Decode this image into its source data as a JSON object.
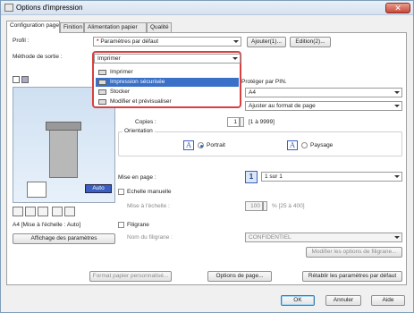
{
  "window": {
    "title": "Options d'impression",
    "close_glyph": "✕"
  },
  "tabs": [
    {
      "label": "Configuration page"
    },
    {
      "label": "Finition"
    },
    {
      "label": "Alimentation papier"
    },
    {
      "label": "Qualité"
    }
  ],
  "profile": {
    "label": "Profil :",
    "value": "Paramètres par défaut",
    "add_label": "Ajouter(1)...",
    "edit_label": "Edition(2)..."
  },
  "output_method": {
    "label": "Méthode de sortie :",
    "value": "Imprimer",
    "options": [
      "Imprimer",
      "Impression sécurisée",
      "Stocker",
      "Modifier et prévisualiser"
    ],
    "selected_index": 1
  },
  "pin_label": "Protéger par PIN.",
  "page_size_value": "A4",
  "output_size_value": "Ajuster au format de page",
  "copies": {
    "label": "Copies :",
    "value": "1",
    "range": "[1 à 9999]"
  },
  "orientation": {
    "label": "Orientation",
    "portrait_label": "Portrait",
    "landscape_label": "Paysage",
    "icon_letter": "A"
  },
  "layout": {
    "label": "Mise en page :",
    "value": "1 sur 1",
    "icon_digit": "1"
  },
  "manual_scale": {
    "label": "Echelle manuelle",
    "scale_label": "Mise à l'échelle :",
    "value": "100",
    "range": "% [25 à 400]"
  },
  "watermark": {
    "label": "Filigrane",
    "name_label": "Nom du filigrane :",
    "value": "CONFIDENTIEL",
    "edit_label": "Modifier les options de filigrane..."
  },
  "preview": {
    "auto_label": "Auto",
    "caption": "A4 [Mise à l'échelle : Auto]",
    "show_settings_label": "Affichage des paramètres"
  },
  "bottom_buttons": {
    "custom_paper": "Format papier personnalisé...",
    "page_options": "Options de page...",
    "restore_defaults": "Rétablir les paramètres par défaut"
  },
  "dialog_buttons": {
    "ok": "OK",
    "cancel": "Annuler",
    "help": "Aide"
  },
  "colors": {
    "selection": "#3a70c8",
    "highlight_border": "#d84040",
    "title_bar": "#d6e2f0"
  }
}
